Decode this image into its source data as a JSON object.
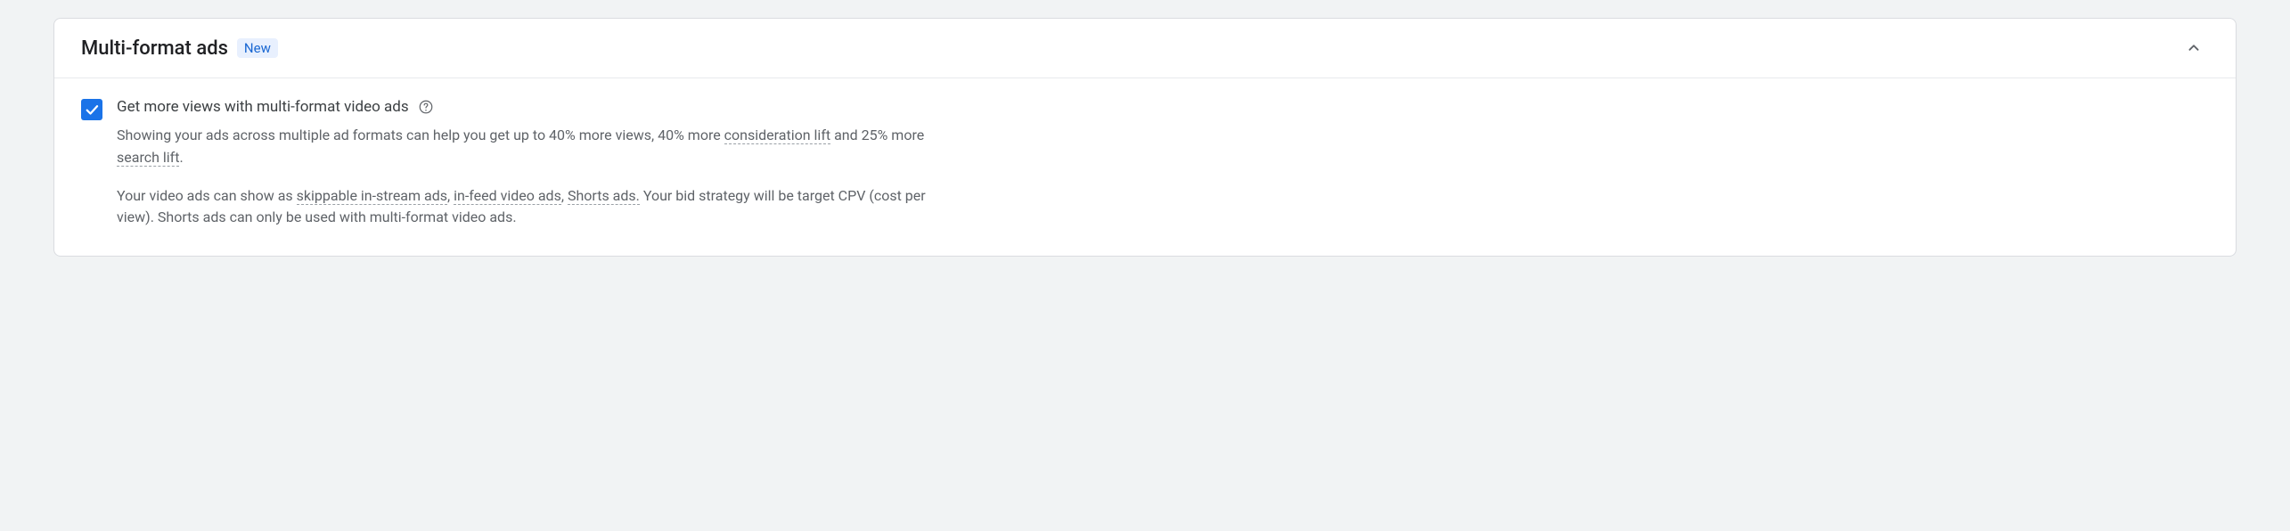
{
  "section": {
    "title": "Multi-format ads",
    "badge": "New"
  },
  "checkbox": {
    "label": "Get more views with multi-format video ads"
  },
  "desc1": {
    "pre": "Showing your ads across multiple ad formats can help you get up to 40% more views, 40% more ",
    "term1": "consideration lift",
    "mid": " and 25% more ",
    "term2": "search lift",
    "post": "."
  },
  "desc2": {
    "pre": "Your video ads can show as ",
    "term1": "skippable in-stream ads",
    "sep1": ", ",
    "term2": "in-feed video ads",
    "sep2": ", ",
    "term3": "Shorts ads.",
    "post": " Your bid strategy will be target CPV (cost per view). Shorts ads can only be used with multi-format video ads."
  }
}
